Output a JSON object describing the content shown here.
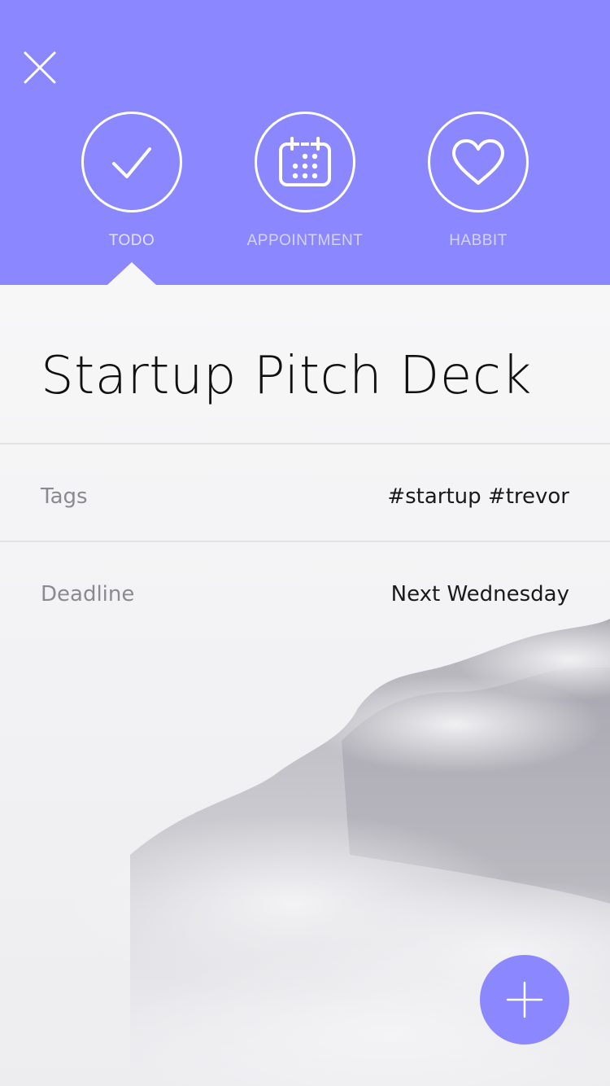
{
  "header": {
    "close_icon": "close-icon",
    "tabs": [
      {
        "label": "TODO",
        "icon": "check-icon",
        "active": true
      },
      {
        "label": "APPOINTMENT",
        "icon": "calendar-icon",
        "active": false
      },
      {
        "label": "HABBIT",
        "icon": "heart-icon",
        "active": false
      }
    ]
  },
  "task": {
    "title": "Startup Pitch Deck",
    "fields": [
      {
        "key": "Tags",
        "value": "#startup #trevor"
      },
      {
        "key": "Deadline",
        "value": "Next Wednesday"
      }
    ]
  },
  "fab": {
    "icon": "plus-icon"
  },
  "colors": {
    "accent": "#8b88ff",
    "background": "#f6f6f7",
    "text": "#111111",
    "muted": "#8a8a8f"
  }
}
